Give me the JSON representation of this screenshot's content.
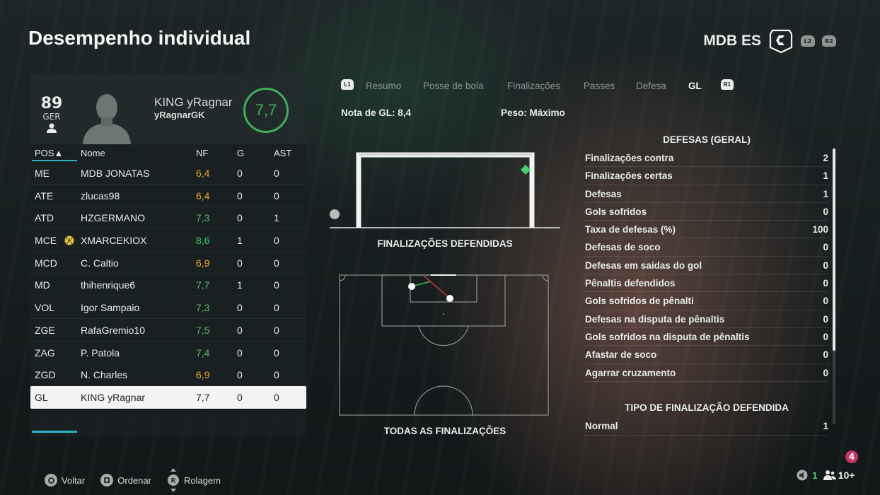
{
  "header": {
    "title": "Desempenho individual",
    "team_name": "MDB ES",
    "left_bumper": "L2",
    "right_bumper": "R2"
  },
  "player": {
    "overall": "89",
    "nationality": "GER",
    "name": "KING yRagnar",
    "gamertag": "yRagnarGK",
    "rating": "7,7"
  },
  "table": {
    "headers": {
      "pos": "POS▲",
      "name": "Nome",
      "nf": "NF",
      "g": "G",
      "ast": "AST"
    },
    "rows": [
      {
        "pos": "ME",
        "name": "MDB JONATAS",
        "nf": "6,4",
        "g": "0",
        "ast": "0",
        "nf_color": "#e8a628"
      },
      {
        "pos": "ATE",
        "name": "zlucas98",
        "nf": "6,4",
        "g": "0",
        "ast": "0",
        "nf_color": "#e8a628"
      },
      {
        "pos": "ATD",
        "name": "HZGERMANO",
        "nf": "7,3",
        "g": "0",
        "ast": "1",
        "nf_color": "#5db365"
      },
      {
        "pos": "MCE",
        "name": "XMARCEKIOX",
        "nf": "8,6",
        "g": "1",
        "ast": "0",
        "nf_color": "#3fd26a",
        "icon": "ball-icon"
      },
      {
        "pos": "MCD",
        "name": "C. Caltio",
        "nf": "6,9",
        "g": "0",
        "ast": "0",
        "nf_color": "#e8a628"
      },
      {
        "pos": "MD",
        "name": "thihenrique6",
        "nf": "7,7",
        "g": "1",
        "ast": "0",
        "nf_color": "#5db365"
      },
      {
        "pos": "VOL",
        "name": "Igor Sampaio",
        "nf": "7,3",
        "g": "0",
        "ast": "0",
        "nf_color": "#5db365"
      },
      {
        "pos": "ZGE",
        "name": "RafaGremio10",
        "nf": "7,5",
        "g": "0",
        "ast": "0",
        "nf_color": "#5db365"
      },
      {
        "pos": "ZAG",
        "name": "P. Patola",
        "nf": "7,4",
        "g": "0",
        "ast": "0",
        "nf_color": "#5db365"
      },
      {
        "pos": "ZGD",
        "name": "N. Charles",
        "nf": "6,9",
        "g": "0",
        "ast": "0",
        "nf_color": "#e8a628"
      },
      {
        "pos": "GL",
        "name": "KING yRagnar",
        "nf": "7,7",
        "g": "0",
        "ast": "0",
        "nf_color": "#1b1f20",
        "selected": true
      }
    ]
  },
  "tabs": {
    "left_trigger": "L1",
    "right_trigger": "R1",
    "items": [
      {
        "label": "Resumo",
        "active": false
      },
      {
        "label": "Posse de bola",
        "active": false
      },
      {
        "label": "Finalizações",
        "active": false
      },
      {
        "label": "Passes",
        "active": false
      },
      {
        "label": "Defesa",
        "active": false
      },
      {
        "label": "GL",
        "active": true
      }
    ]
  },
  "gk_info": {
    "rating_label": "Nota de GL: 8,4",
    "weight_label": "Peso: Máximo"
  },
  "visuals": {
    "goal_caption": "FINALIZAÇÕES DEFENDIDAS",
    "pitch_caption": "TODAS AS FINALIZAÇÕES"
  },
  "stats": {
    "title": "DEFESAS (GERAL)",
    "items": [
      {
        "label": "Finalizações contra",
        "value": "2"
      },
      {
        "label": "Finalizações certas",
        "value": "1"
      },
      {
        "label": "Defesas",
        "value": "1"
      },
      {
        "label": "Gols sofridos",
        "value": "0"
      },
      {
        "label": "Taxa de defesas (%)",
        "value": "100"
      },
      {
        "label": "Defesas de soco",
        "value": "0"
      },
      {
        "label": "Defesas em saídas do gol",
        "value": "0"
      },
      {
        "label": "Pênaltis defendidos",
        "value": "0"
      },
      {
        "label": "Gols sofridos de pênalti",
        "value": "0"
      },
      {
        "label": "Defesas na disputa de pênaltis",
        "value": "0"
      },
      {
        "label": "Gols sofridos na disputa de pênaltis",
        "value": "0"
      },
      {
        "label": "Afastar de soco",
        "value": "0"
      },
      {
        "label": "Agarrar cruzamento",
        "value": "0"
      }
    ],
    "tipo_title": "TIPO DE FINALIZAÇÃO DEFENDIDA",
    "tipo_items": [
      {
        "label": "Normal",
        "value": "1"
      }
    ]
  },
  "footer": {
    "back_label": "Voltar",
    "sort_label": "Ordenar",
    "scroll_label": "Rolagem",
    "notifications": "4",
    "online_count": "1",
    "party_count": "10+"
  }
}
